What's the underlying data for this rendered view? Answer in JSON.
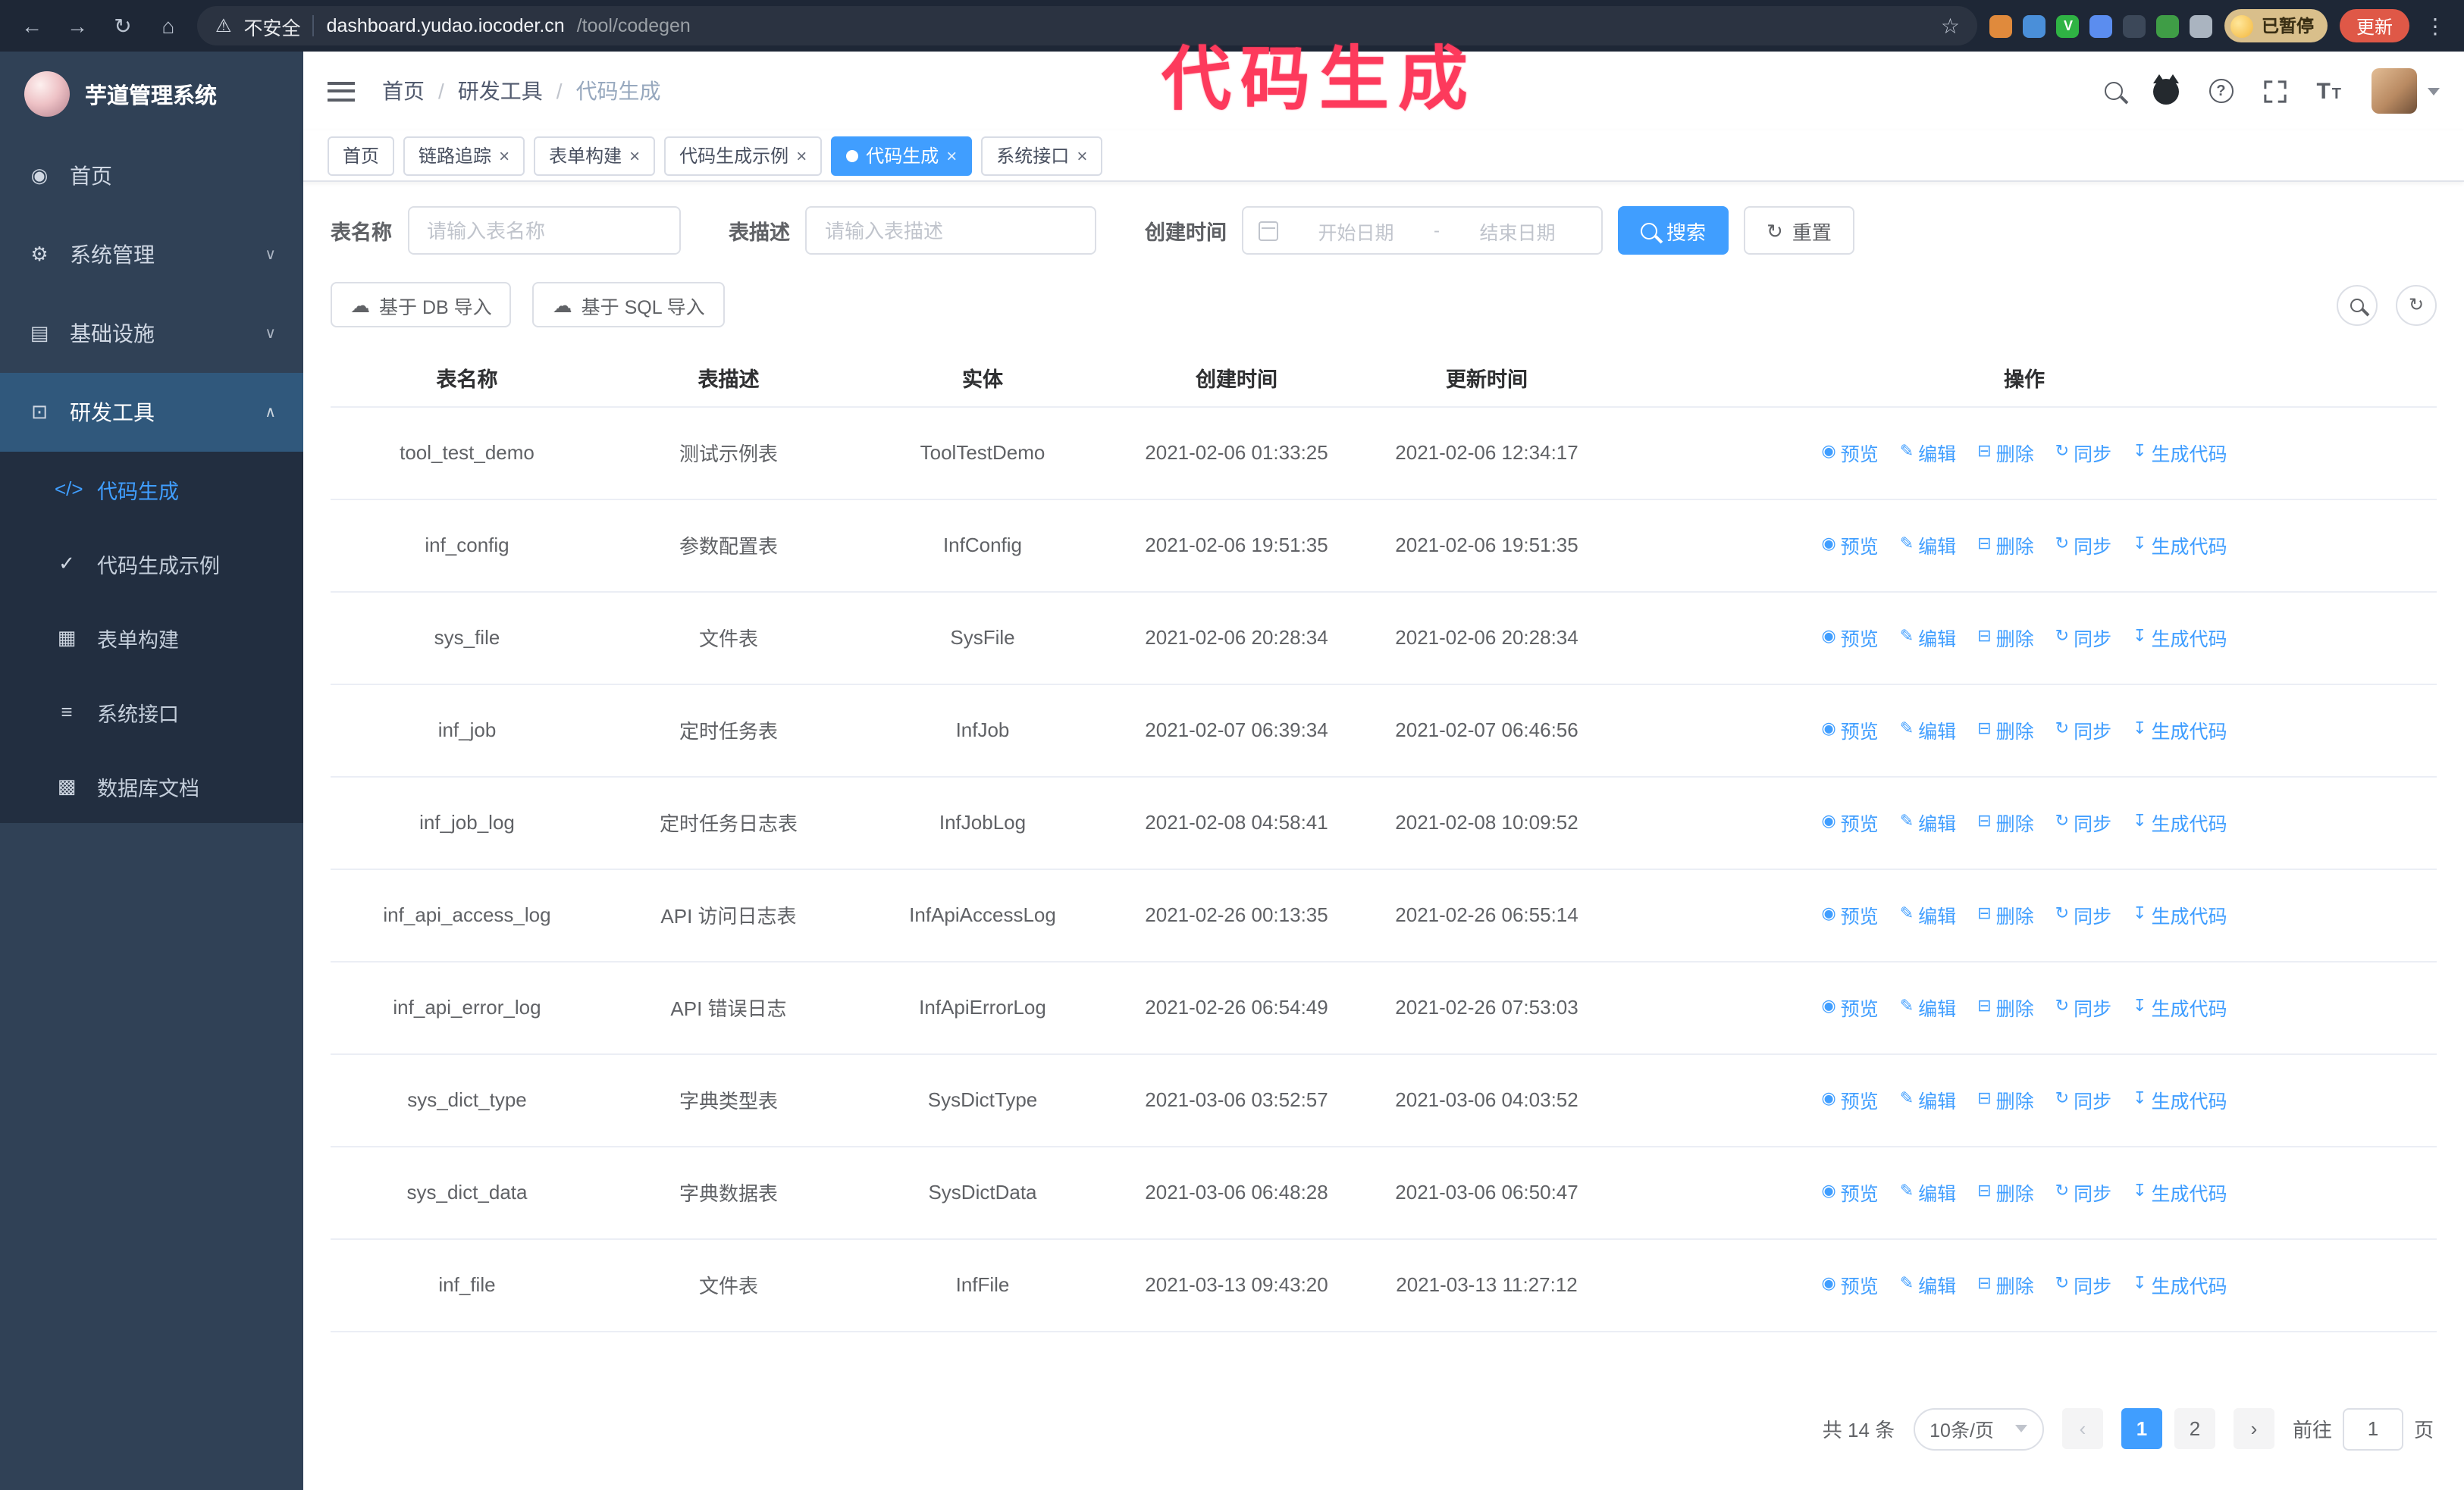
{
  "annotation": {
    "text": "代码生成",
    "color": "#fd3a5c"
  },
  "browser": {
    "security_label": "不安全",
    "url_host": "dashboard.yudao.iocoder.cn",
    "url_path": "/tool/codegen",
    "profile_chip": "已暂停",
    "update_button": "更新",
    "extensions": [
      {
        "name": "extension-icon-1",
        "color": "#e08a3c",
        "glyph": ""
      },
      {
        "name": "extension-icon-2",
        "color": "#4a8fd9",
        "glyph": ""
      },
      {
        "name": "extension-icon-3",
        "color": "#2fb344",
        "glyph": "V"
      },
      {
        "name": "extension-icon-4",
        "color": "#5b8def",
        "glyph": ""
      },
      {
        "name": "extension-icon-5",
        "color": "#3c4859",
        "glyph": ""
      },
      {
        "name": "extension-icon-6",
        "color": "#3f9d46",
        "glyph": ""
      },
      {
        "name": "extension-icon-7",
        "color": "#aab4c0",
        "glyph": ""
      }
    ]
  },
  "sidebar": {
    "logo_title": "芋道管理系统",
    "menu": [
      {
        "id": "home",
        "label": "首页",
        "icon": "home-icon"
      },
      {
        "id": "system-mgmt",
        "label": "系统管理",
        "icon": "gear-icon",
        "expandable": true
      },
      {
        "id": "infra",
        "label": "基础设施",
        "icon": "infra-icon",
        "expandable": true
      },
      {
        "id": "devtools",
        "label": "研发工具",
        "icon": "tools-icon",
        "expandable": true,
        "expanded": true,
        "active": true,
        "children": [
          {
            "id": "codegen",
            "label": "代码生成",
            "icon": "code-icon",
            "active": true
          },
          {
            "id": "codegen-example",
            "label": "代码生成示例",
            "icon": "badge-icon"
          },
          {
            "id": "form-builder",
            "label": "表单构建",
            "icon": "form-icon"
          },
          {
            "id": "system-api",
            "label": "系统接口",
            "icon": "api-icon"
          },
          {
            "id": "db-doc",
            "label": "数据库文档",
            "icon": "db-icon"
          }
        ]
      }
    ]
  },
  "header": {
    "breadcrumb": [
      {
        "id": "home",
        "label": "首页"
      },
      {
        "id": "devtools",
        "label": "研发工具"
      },
      {
        "id": "codegen",
        "label": "代码生成",
        "current": true
      }
    ]
  },
  "tabs": [
    {
      "id": "home",
      "label": "首页",
      "closable": false
    },
    {
      "id": "tracer",
      "label": "链路追踪",
      "closable": true
    },
    {
      "id": "form-builder",
      "label": "表单构建",
      "closable": true
    },
    {
      "id": "codegen-example",
      "label": "代码生成示例",
      "closable": true
    },
    {
      "id": "codegen",
      "label": "代码生成",
      "closable": true,
      "active": true
    },
    {
      "id": "system-api",
      "label": "系统接口",
      "closable": true
    }
  ],
  "filters": {
    "table_name_label": "表名称",
    "table_name_placeholder": "请输入表名称",
    "table_desc_label": "表描述",
    "table_desc_placeholder": "请输入表描述",
    "create_time_label": "创建时间",
    "date_start_placeholder": "开始日期",
    "date_separator": "-",
    "date_end_placeholder": "结束日期",
    "search_button": "搜索",
    "reset_button": "重置"
  },
  "toolbar": {
    "import_db_button": "基于 DB 导入",
    "import_sql_button": "基于 SQL 导入"
  },
  "table": {
    "columns": [
      "表名称",
      "表描述",
      "实体",
      "创建时间",
      "更新时间",
      "操作"
    ],
    "actions": [
      {
        "name": "preview",
        "label": "预览",
        "icon": "eye-icon"
      },
      {
        "name": "edit",
        "label": "编辑",
        "icon": "edit-icon"
      },
      {
        "name": "delete",
        "label": "删除",
        "icon": "delete-icon"
      },
      {
        "name": "sync",
        "label": "同步",
        "icon": "sync-icon"
      },
      {
        "name": "generate-code",
        "label": "生成代码",
        "icon": "download-icon"
      }
    ],
    "rows": [
      {
        "name": "tool_test_demo",
        "desc": "测试示例表",
        "entity": "ToolTestDemo",
        "created": "2021-02-06 01:33:25",
        "updated": "2021-02-06 12:34:17"
      },
      {
        "name": "inf_config",
        "desc": "参数配置表",
        "entity": "InfConfig",
        "created": "2021-02-06 19:51:35",
        "updated": "2021-02-06 19:51:35"
      },
      {
        "name": "sys_file",
        "desc": "文件表",
        "entity": "SysFile",
        "created": "2021-02-06 20:28:34",
        "updated": "2021-02-06 20:28:34"
      },
      {
        "name": "inf_job",
        "desc": "定时任务表",
        "entity": "InfJob",
        "created": "2021-02-07 06:39:34",
        "updated": "2021-02-07 06:46:56"
      },
      {
        "name": "inf_job_log",
        "desc": "定时任务日志表",
        "entity": "InfJobLog",
        "created": "2021-02-08 04:58:41",
        "updated": "2021-02-08 10:09:52"
      },
      {
        "name": "inf_api_access_log",
        "desc": "API 访问日志表",
        "entity": "InfApiAccessLog",
        "created": "2021-02-26 00:13:35",
        "updated": "2021-02-26 06:55:14"
      },
      {
        "name": "inf_api_error_log",
        "desc": "API 错误日志",
        "entity": "InfApiErrorLog",
        "created": "2021-02-26 06:54:49",
        "updated": "2021-02-26 07:53:03"
      },
      {
        "name": "sys_dict_type",
        "desc": "字典类型表",
        "entity": "SysDictType",
        "created": "2021-03-06 03:52:57",
        "updated": "2021-03-06 04:03:52"
      },
      {
        "name": "sys_dict_data",
        "desc": "字典数据表",
        "entity": "SysDictData",
        "created": "2021-03-06 06:48:28",
        "updated": "2021-03-06 06:50:47"
      },
      {
        "name": "inf_file",
        "desc": "文件表",
        "entity": "InfFile",
        "created": "2021-03-13 09:43:20",
        "updated": "2021-03-13 11:27:12"
      }
    ]
  },
  "pagination": {
    "total": "共 14 条",
    "page_size": "10条/页",
    "pages": [
      "1",
      "2"
    ],
    "active_page": "1",
    "goto_label": "前往",
    "goto_value": "1",
    "goto_suffix": "页"
  }
}
